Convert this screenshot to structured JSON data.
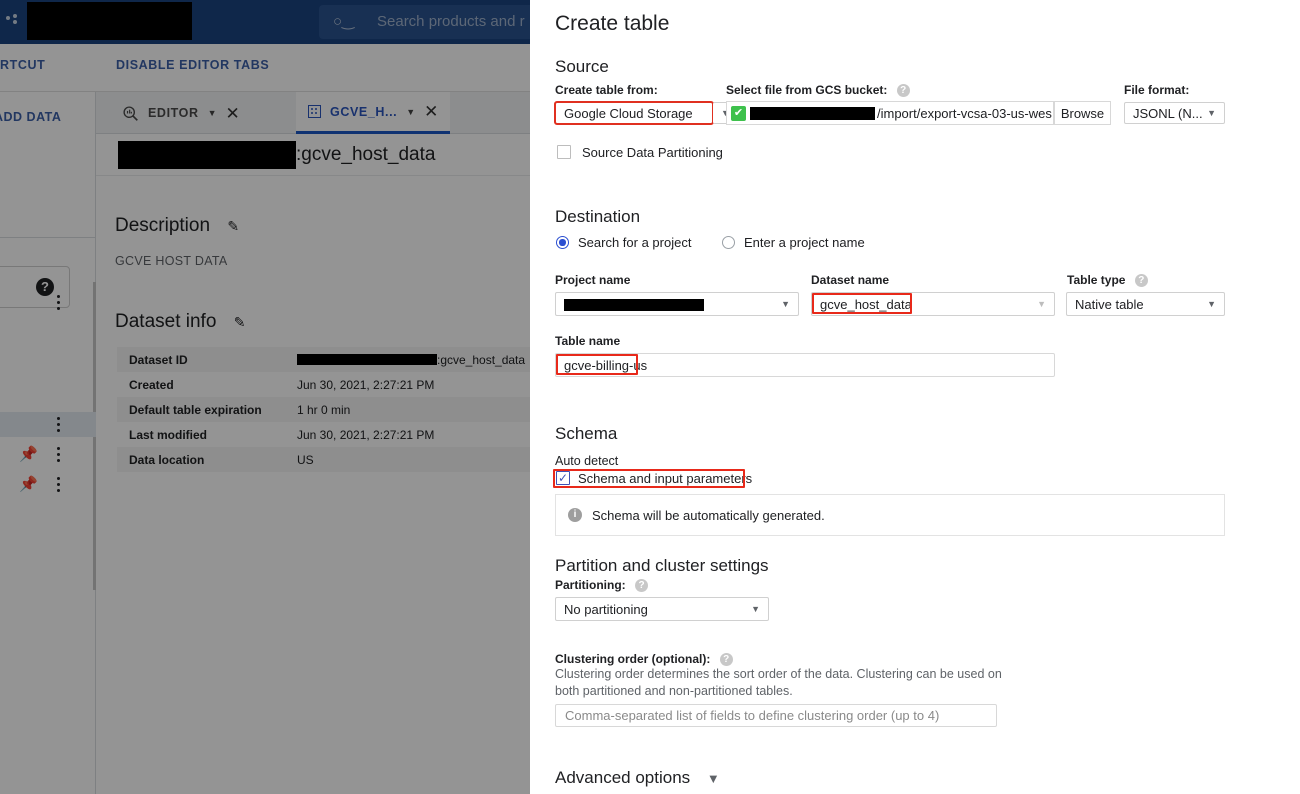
{
  "header": {
    "search_placeholder": "Search products and r",
    "search_icon": "search-icon",
    "logo_icon": "google-cloud-logo-icon",
    "project_redacted": ""
  },
  "subbar": {
    "shortcut_label": "HORTCUT",
    "disable_tabs_label": "DISABLE EDITOR TABS",
    "eye_slash_icon": "eye-slash-icon"
  },
  "rail": {
    "add_data_label": "ADD DATA",
    "help_icon": "help-circle-icon",
    "pin_icon": "pin-icon",
    "more_icon": "more-vertical-icon"
  },
  "tabs": [
    {
      "label": "EDITOR",
      "icon": "query-editor-icon",
      "active": false,
      "close_icon": "close-icon",
      "caret_icon": "chevron-down-icon"
    },
    {
      "label": "GCVE_H...",
      "icon": "table-grid-icon",
      "active": true,
      "close_icon": "close-icon",
      "caret_icon": "chevron-down-icon"
    }
  ],
  "breadcrumb": {
    "suffix": ":gcve_host_data"
  },
  "dataset_page": {
    "description_heading": "Description",
    "description_value": "GCVE HOST DATA",
    "edit_icon": "pencil-icon",
    "dataset_info_heading": "Dataset info",
    "rows": [
      {
        "key": "Dataset ID",
        "value": ":gcve_host_data",
        "redacted": true
      },
      {
        "key": "Created",
        "value": "Jun 30, 2021, 2:27:21 PM",
        "redacted": false
      },
      {
        "key": "Default table expiration",
        "value": "1 hr 0 min",
        "redacted": false
      },
      {
        "key": "Last modified",
        "value": "Jun 30, 2021, 2:27:21 PM",
        "redacted": false
      },
      {
        "key": "Data location",
        "value": "US",
        "redacted": false
      }
    ]
  },
  "modal": {
    "title": "Create table",
    "source": {
      "heading": "Source",
      "create_from_label": "Create table from:",
      "create_from_value": "Google Cloud Storage",
      "gcs_label": "Select file from GCS bucket:",
      "gcs_help_icon": "help-circle-icon",
      "gcs_valid_icon": "check-icon",
      "gcs_path": "/import/export-vcsa-03-us-wes",
      "browse_label": "Browse",
      "file_format_label": "File format:",
      "file_format_value": "JSONL (N...",
      "source_partitioning_label": "Source Data Partitioning",
      "source_partitioning_checked": false
    },
    "destination": {
      "heading": "Destination",
      "radio_search_label": "Search for a project",
      "radio_enter_label": "Enter a project name",
      "radio_selected": "search",
      "project_name_label": "Project name",
      "project_name_value": "",
      "dataset_name_label": "Dataset name",
      "dataset_name_value": "gcve_host_data",
      "table_type_label": "Table type",
      "table_type_help_icon": "help-circle-icon",
      "table_type_value": "Native table",
      "table_name_label": "Table name",
      "table_name_value": "gcve-billing-us"
    },
    "schema": {
      "heading": "Schema",
      "auto_detect_label": "Auto detect",
      "schema_params_label": "Schema and input parameters",
      "schema_params_checked": true,
      "info_icon": "info-circle-icon",
      "info_text": "Schema will be automatically generated."
    },
    "partition": {
      "heading": "Partition and cluster settings",
      "partitioning_label": "Partitioning:",
      "partitioning_help_icon": "help-circle-icon",
      "partitioning_value": "No partitioning",
      "clustering_label": "Clustering order (optional):",
      "clustering_help_icon": "help-circle-icon",
      "clustering_desc": "Clustering order determines the sort order of the data. Clustering can be used on both partitioned and non-partitioned tables.",
      "clustering_placeholder": "Comma-separated list of fields to define clustering order (up to 4)"
    },
    "advanced_label": "Advanced options",
    "advanced_chevron_icon": "chevron-down-icon"
  },
  "colors": {
    "header_blue": "#1a4480",
    "link_blue": "#3c5fa8",
    "accent_blue": "#2b4fd1",
    "highlight_red": "#e8291a",
    "check_green": "#3ec14c"
  }
}
